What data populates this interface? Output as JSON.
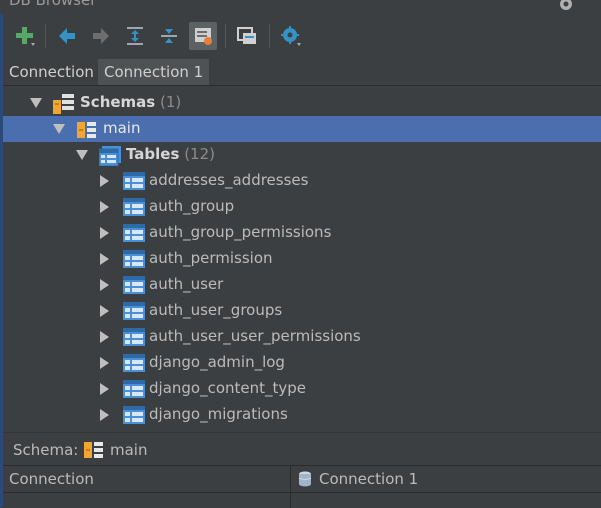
{
  "window": {
    "title": "DB Browser"
  },
  "toolbar": {
    "buttons": [
      {
        "name": "add-button",
        "icon": "plus-icon"
      },
      {
        "name": "back-button",
        "icon": "arrow-left-icon"
      },
      {
        "name": "forward-button",
        "icon": "arrow-right-icon"
      },
      {
        "name": "expand-all-button",
        "icon": "expand-all-icon"
      },
      {
        "name": "collapse-all-button",
        "icon": "collapse-all-icon"
      },
      {
        "name": "filter-button",
        "icon": "filter-icon"
      },
      {
        "name": "open-console-button",
        "icon": "console-icon"
      },
      {
        "name": "settings-button",
        "icon": "gear-icon"
      }
    ]
  },
  "tabs": [
    {
      "label": "Connection",
      "active": false
    },
    {
      "label": "Connection 1",
      "active": true
    }
  ],
  "tree": {
    "schemas": {
      "label": "Schemas",
      "count": "(1)"
    },
    "main": {
      "label": "main"
    },
    "tables": {
      "label": "Tables",
      "count": "(12)"
    },
    "items": [
      "addresses_addresses",
      "auth_group",
      "auth_group_permissions",
      "auth_permission",
      "auth_user",
      "auth_user_groups",
      "auth_user_user_permissions",
      "django_admin_log",
      "django_content_type",
      "django_migrations"
    ]
  },
  "schema_bar": {
    "label": "Schema:",
    "value": "main"
  },
  "status": {
    "left": "Connection",
    "right": "Connection 1"
  },
  "colors": {
    "selection": "#4b6eaf",
    "background": "#3c3f41",
    "schema_icon": "#f0a732",
    "table_icon": "#4a90d9",
    "add_icon": "#59a869"
  }
}
